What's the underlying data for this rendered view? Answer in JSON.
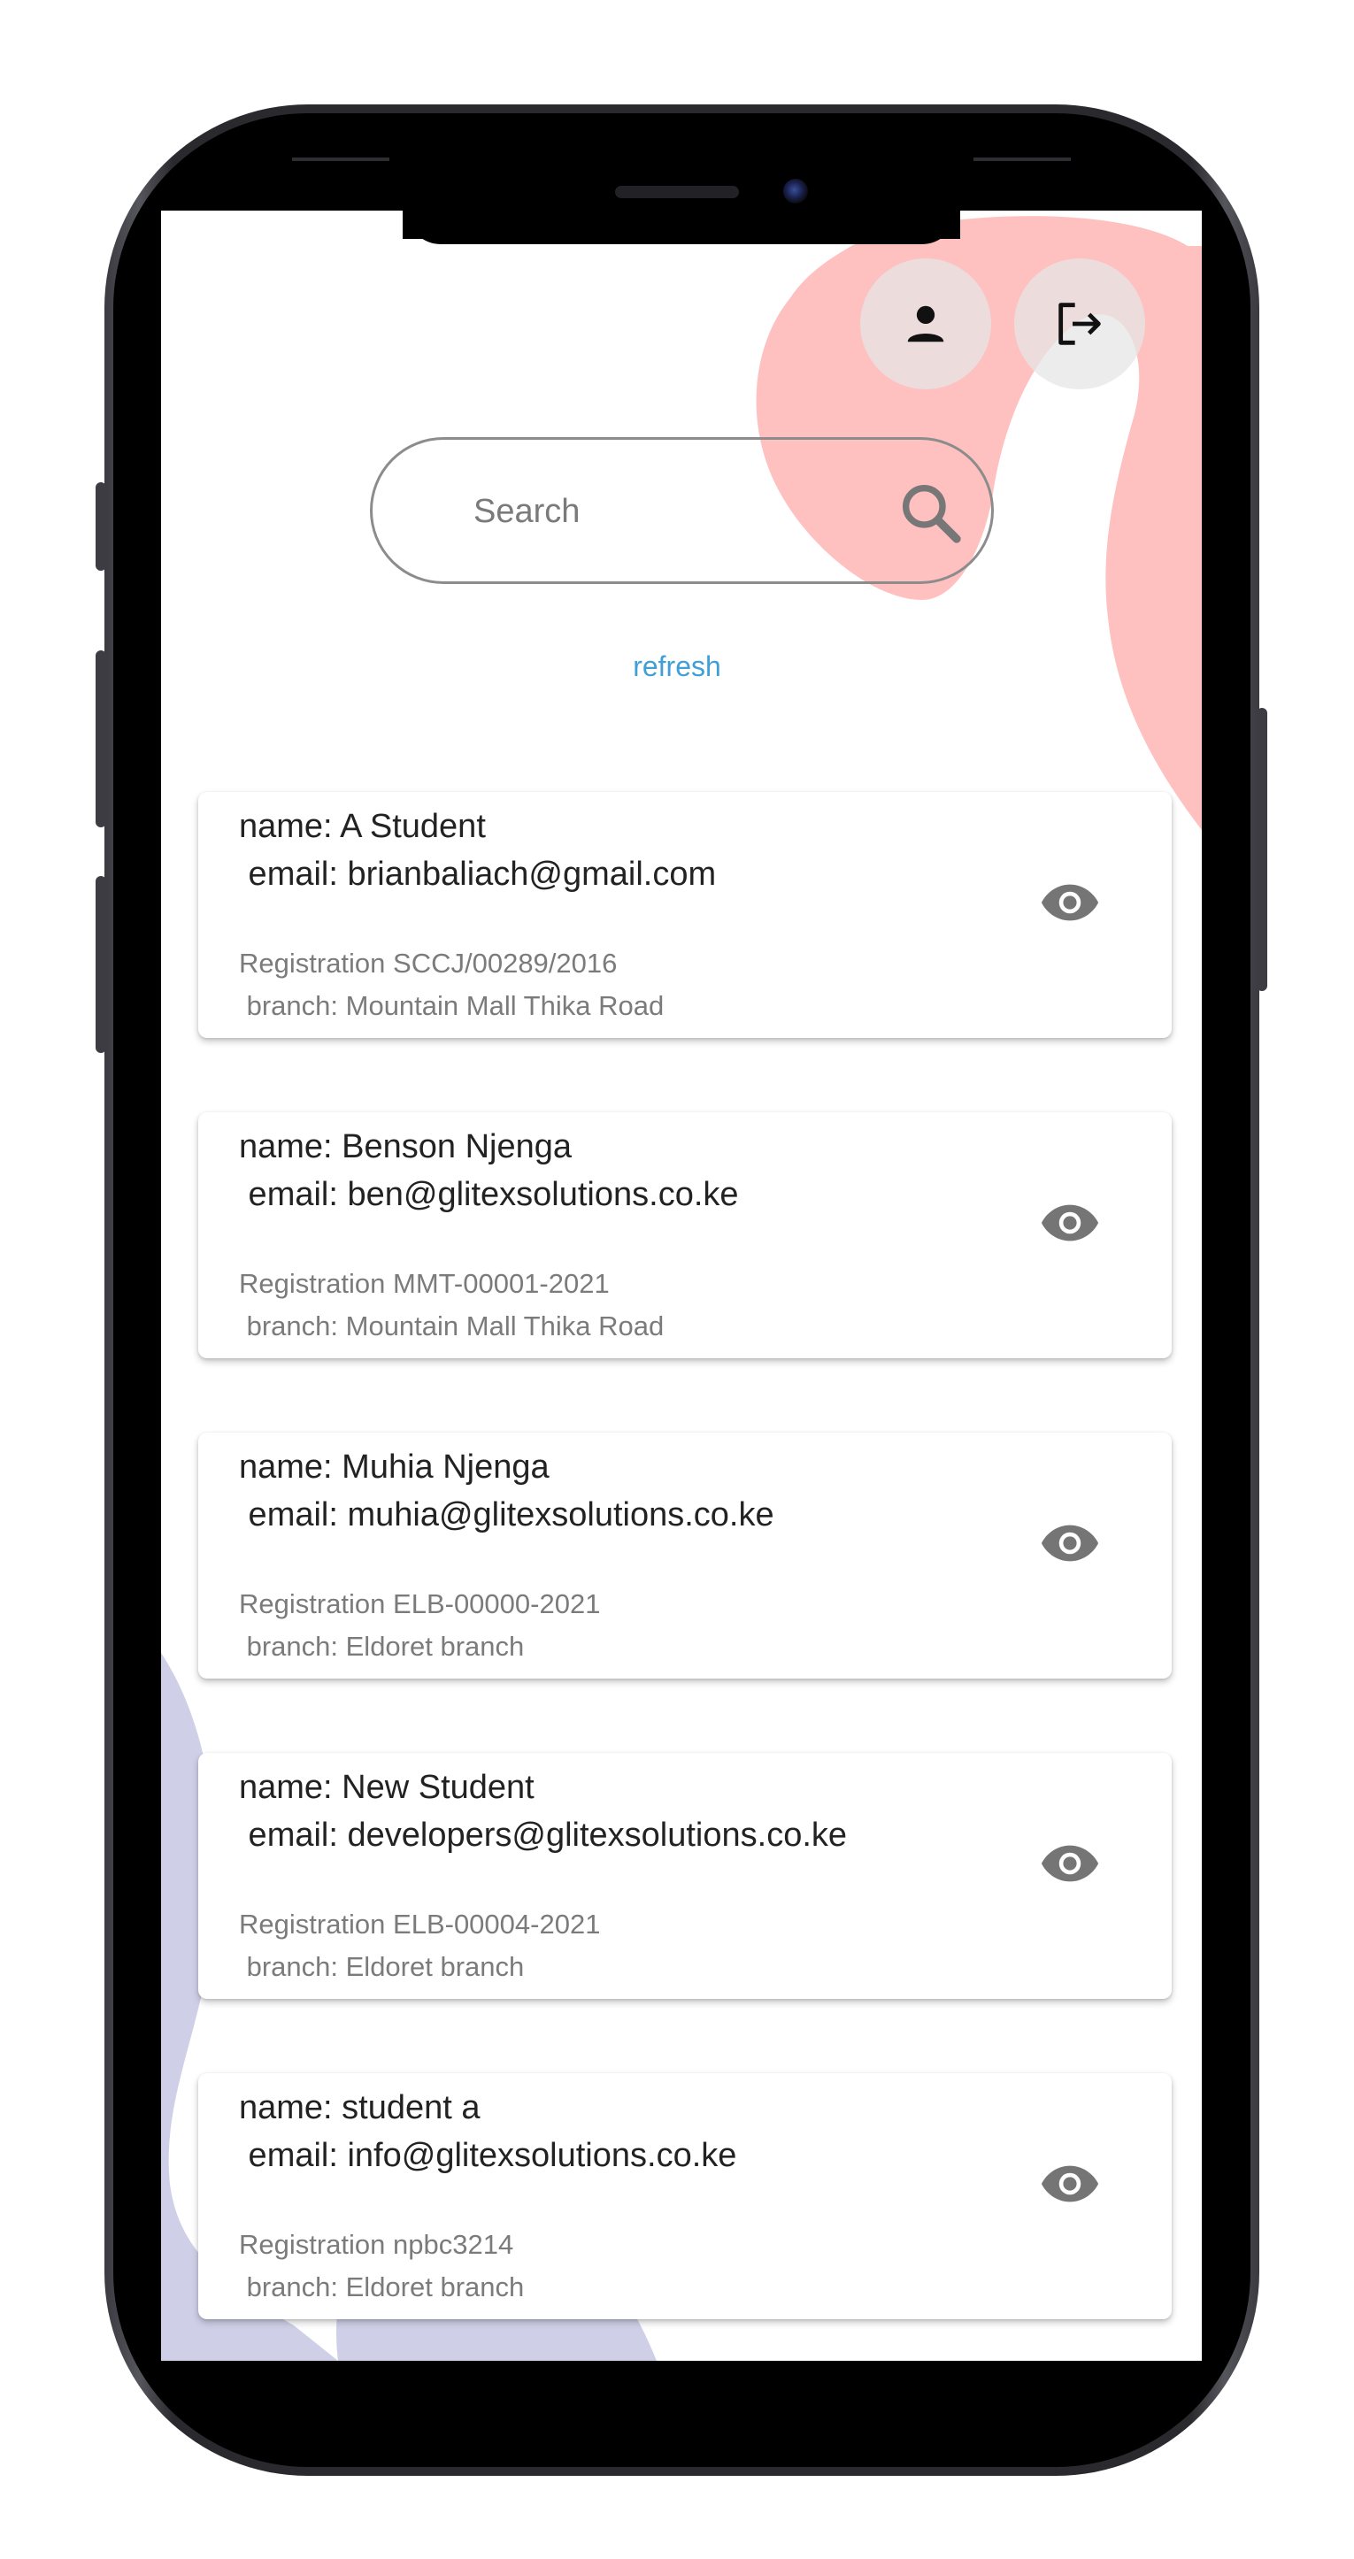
{
  "search": {
    "placeholder": "Search"
  },
  "actions": {
    "refresh_label": "refresh",
    "profile_icon": "person-icon",
    "logout_icon": "logout-icon"
  },
  "students": [
    {
      "name": "name: A Student",
      "email": " email: brianbaliach@gmail.com",
      "registration": "Registration SCCJ/00289/2016",
      "branch": " branch: Mountain Mall Thika Road"
    },
    {
      "name": "name: Benson Njenga",
      "email": " email: ben@glitexsolutions.co.ke",
      "registration": "Registration MMT-00001-2021",
      "branch": " branch: Mountain Mall Thika Road"
    },
    {
      "name": "name: Muhia Njenga",
      "email": " email: muhia@glitexsolutions.co.ke",
      "registration": "Registration ELB-00000-2021",
      "branch": " branch: Eldoret branch"
    },
    {
      "name": "name: New Student",
      "email": " email: developers@glitexsolutions.co.ke",
      "registration": "Registration ELB-00004-2021",
      "branch": " branch: Eldoret branch"
    },
    {
      "name": "name: student a",
      "email": " email: info@glitexsolutions.co.ke",
      "registration": "Registration npbc3214",
      "branch": " branch: Eldoret branch"
    }
  ],
  "colors": {
    "accent_link": "#3f9fd6",
    "blob_pink": "#ffc0c0",
    "blob_lavender": "#cfd0e8"
  }
}
